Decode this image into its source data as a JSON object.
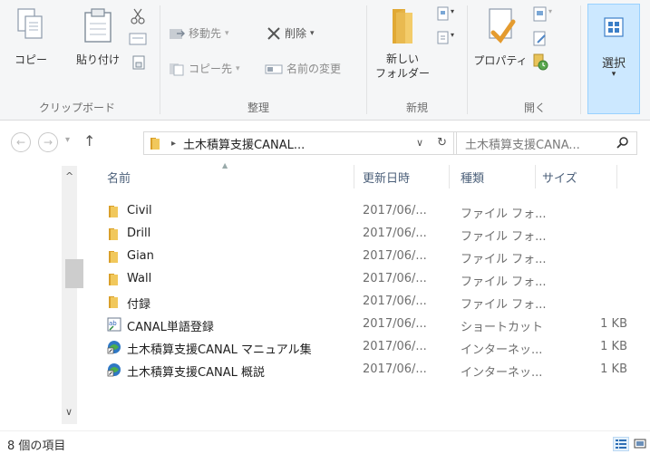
{
  "ribbon": {
    "clipboard": {
      "copy": "コピー",
      "paste": "貼り付け",
      "group_label": "クリップボード"
    },
    "organize": {
      "move_to": "移動先",
      "delete": "削除",
      "copy_to": "コピー先",
      "rename": "名前の変更",
      "group_label": "整理"
    },
    "new": {
      "new_folder_line1": "新しい",
      "new_folder_line2": "フォルダー",
      "group_label": "新規"
    },
    "open": {
      "properties": "プロパティ",
      "group_label": "開く"
    },
    "select": {
      "select": "選択"
    }
  },
  "nav": {
    "address_path": "土木積算支援CANAL...",
    "search_placeholder": "土木積算支援CANA..."
  },
  "columns": {
    "name": "名前",
    "date": "更新日時",
    "type": "種類",
    "size": "サイズ"
  },
  "files": [
    {
      "name": "Civil",
      "date": "2017/06/...",
      "type": "ファイル フォ...",
      "size": "",
      "icon": "folder-icon"
    },
    {
      "name": "Drill",
      "date": "2017/06/...",
      "type": "ファイル フォ...",
      "size": "",
      "icon": "folder-icon"
    },
    {
      "name": "Gian",
      "date": "2017/06/...",
      "type": "ファイル フォ...",
      "size": "",
      "icon": "folder-icon"
    },
    {
      "name": "Wall",
      "date": "2017/06/...",
      "type": "ファイル フォ...",
      "size": "",
      "icon": "folder-icon"
    },
    {
      "name": "付録",
      "date": "2017/06/...",
      "type": "ファイル フォ...",
      "size": "",
      "icon": "folder-icon"
    },
    {
      "name": "CANAL単語登録",
      "date": "2017/06/...",
      "type": "ショートカット",
      "size": "1 KB",
      "icon": "shortcut-icon"
    },
    {
      "name": "土木積算支援CANAL マニュアル集",
      "date": "2017/06/...",
      "type": "インターネッ...",
      "size": "1 KB",
      "icon": "internet-shortcut-icon"
    },
    {
      "name": "土木積算支援CANAL 概説",
      "date": "2017/06/...",
      "type": "インターネッ...",
      "size": "1 KB",
      "icon": "internet-shortcut-icon"
    }
  ],
  "status": {
    "item_count": "8 個の項目"
  },
  "colors": {
    "folder": "#e8b84a",
    "accent": "#0078d7",
    "ribbon_bg": "#f5f6f7"
  }
}
